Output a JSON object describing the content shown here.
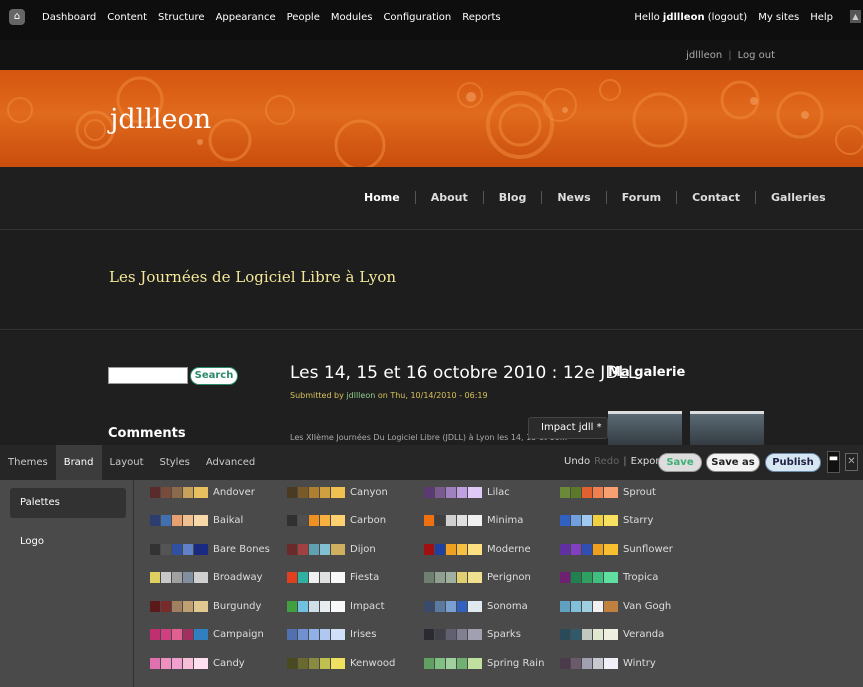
{
  "toolbar": {
    "home_icon": "⌂",
    "left_items": [
      "Dashboard",
      "Content",
      "Structure",
      "Appearance",
      "People",
      "Modules",
      "Configuration",
      "Reports"
    ],
    "hello_prefix": "Hello",
    "username": "jdllleon",
    "logout_label": "(logout)",
    "my_sites": "My sites",
    "help": "Help",
    "collapse_icon": "▲"
  },
  "userbar": {
    "username": "jdllleon",
    "separator": "|",
    "logout": "Log out"
  },
  "site": {
    "name": "jdllleon",
    "slogan": "Les Journées de Logiciel Libre à Lyon"
  },
  "mainnav": {
    "items": [
      "Home",
      "About",
      "Blog",
      "News",
      "Forum",
      "Contact",
      "Galleries"
    ]
  },
  "search": {
    "button": "Search"
  },
  "sidebar_block": {
    "comments_title": "Comments"
  },
  "article": {
    "title": "Les 14, 15 et 16 octobre 2010 : 12e JDLL",
    "submitted_prefix": "Submitted by",
    "author": "jdllleon",
    "submitted_suffix": "on Thu, 10/14/2010 - 06:19",
    "body_start": "Les XIIème Journées Du Logiciel Libre (JDLL) à Lyon les 14, 15 et 16..."
  },
  "gallery": {
    "title": "Ma galerie"
  },
  "tooltip": "Impact jdll *",
  "builder": {
    "tabs": [
      "Themes",
      "Brand",
      "Layout",
      "Styles",
      "Advanced"
    ],
    "active_tab": "Brand",
    "undo": "Undo",
    "redo": "Redo",
    "export": "Export",
    "save": "Save",
    "save_as": "Save as",
    "publish": "Publish",
    "minimize_icon": "▬",
    "close_icon": "✕",
    "sidebar": [
      "Palettes",
      "Logo"
    ]
  },
  "palettes": [
    {
      "name": "Andover",
      "colors": [
        "#5a2b2b",
        "#7a4a3a",
        "#8a6a4a",
        "#c8a25a",
        "#e8c060"
      ]
    },
    {
      "name": "Baikal",
      "colors": [
        "#2c3e70",
        "#4070b0",
        "#e8a070",
        "#f0c090",
        "#f8d8a8"
      ]
    },
    {
      "name": "Bare Bones",
      "colors": [
        "#333333",
        "#555555",
        "#3050a0",
        "#6080c8",
        "#1a2a80"
      ]
    },
    {
      "name": "Broadway",
      "colors": [
        "#e0d060",
        "#c8c8c8",
        "#a0a0a0",
        "#8090a0",
        "#d0d0d0"
      ]
    },
    {
      "name": "Burgundy",
      "colors": [
        "#5a1a1a",
        "#7a2a2a",
        "#a08060",
        "#c0a070",
        "#e0c890"
      ]
    },
    {
      "name": "Campaign",
      "colors": [
        "#c03070",
        "#d04080",
        "#e06090",
        "#a03060",
        "#3080c0"
      ]
    },
    {
      "name": "Candy",
      "colors": [
        "#e070b0",
        "#f090c0",
        "#f0a0d0",
        "#f8c0d8",
        "#ffe0f0"
      ]
    },
    {
      "name": "Canyon",
      "colors": [
        "#4a3a20",
        "#7a5a28",
        "#b08030",
        "#d0a040",
        "#f0c050"
      ]
    },
    {
      "name": "Carbon",
      "colors": [
        "#303030",
        "#505050",
        "#f09020",
        "#f8b040",
        "#ffd070"
      ]
    },
    {
      "name": "Dijon",
      "colors": [
        "#6a2a2a",
        "#a04040",
        "#60a0b0",
        "#80c0d0",
        "#d0b060"
      ]
    },
    {
      "name": "Fiesta",
      "colors": [
        "#e04020",
        "#30b0a0",
        "#f0f0f0",
        "#e0e0e0",
        "#f8f8f8"
      ]
    },
    {
      "name": "Impact",
      "colors": [
        "#40a040",
        "#70c0e0",
        "#d0e0e8",
        "#e8eef0",
        "#f8f8f8"
      ]
    },
    {
      "name": "Irises",
      "colors": [
        "#5070b0",
        "#7090d0",
        "#90b0e8",
        "#b0c8f0",
        "#d0e0f8"
      ]
    },
    {
      "name": "Kenwood",
      "colors": [
        "#4a4a20",
        "#6a6a30",
        "#8a8a40",
        "#c0c050",
        "#f0e060"
      ]
    },
    {
      "name": "Lilac",
      "colors": [
        "#5a3a70",
        "#7a5a90",
        "#a080c0",
        "#c0a0e0",
        "#e0c8f8"
      ]
    },
    {
      "name": "Minima",
      "colors": [
        "#f07010",
        "#404040",
        "#d0d0d0",
        "#e0e0e0",
        "#f0f0f0"
      ]
    },
    {
      "name": "Moderne",
      "colors": [
        "#a01010",
        "#2040a0",
        "#f0a020",
        "#f8c040",
        "#ffe080"
      ]
    },
    {
      "name": "Perignon",
      "colors": [
        "#708070",
        "#90a090",
        "#a0b0a0",
        "#e0d070",
        "#f0e090"
      ]
    },
    {
      "name": "Sonoma",
      "colors": [
        "#3a4a6a",
        "#5a7aa0",
        "#7aa0d0",
        "#3060c0",
        "#e0e8f0"
      ]
    },
    {
      "name": "Sparks",
      "colors": [
        "#2a2a30",
        "#404048",
        "#606070",
        "#808090",
        "#a0a0b0"
      ]
    },
    {
      "name": "Spring Rain",
      "colors": [
        "#60a060",
        "#80c080",
        "#a0d0a0",
        "#70b070",
        "#c0e0a0"
      ]
    },
    {
      "name": "Sprout",
      "colors": [
        "#6a8a3a",
        "#5a7a2a",
        "#e06030",
        "#f08050",
        "#f8a070"
      ]
    },
    {
      "name": "Starry",
      "colors": [
        "#3060c0",
        "#70a0e0",
        "#a0c8f0",
        "#f0d040",
        "#f8e060"
      ]
    },
    {
      "name": "Sunflower",
      "colors": [
        "#6030a0",
        "#8040c0",
        "#3050b0",
        "#f0a020",
        "#f8c030"
      ]
    },
    {
      "name": "Tropica",
      "colors": [
        "#702070",
        "#208050",
        "#30a060",
        "#40c080",
        "#60e0a0"
      ]
    },
    {
      "name": "Van Gogh",
      "colors": [
        "#60a0c0",
        "#80c0d8",
        "#a0d0e0",
        "#f0f0f0",
        "#c08040"
      ]
    },
    {
      "name": "Veranda",
      "colors": [
        "#2a4a5a",
        "#305a6a",
        "#c0c8c0",
        "#e0e8d0",
        "#f0f0e0"
      ]
    },
    {
      "name": "Wintry",
      "colors": [
        "#4a3a4a",
        "#6a5a6a",
        "#a0a0b0",
        "#c8c8d0",
        "#f0f0f8"
      ]
    }
  ]
}
